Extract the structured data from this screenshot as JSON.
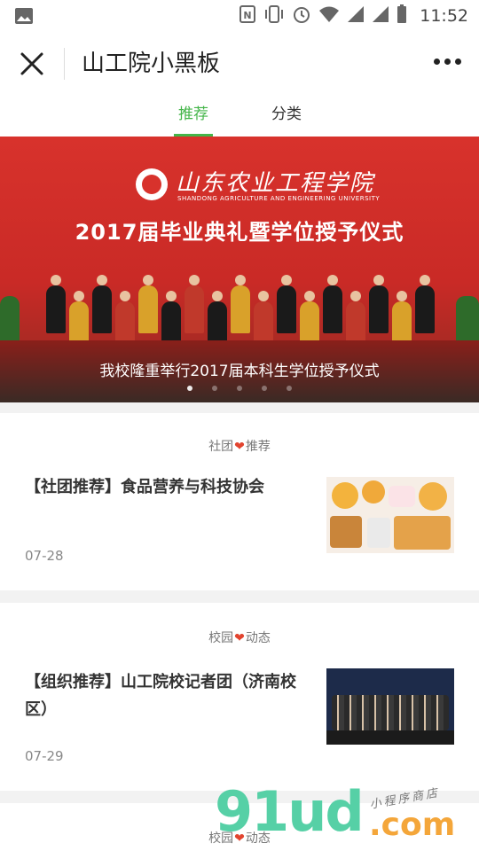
{
  "status_bar": {
    "time": "11:52",
    "icons": [
      "image-icon",
      "nfc-icon",
      "vibrate-icon",
      "alarm-icon",
      "wifi-icon",
      "signal-icon",
      "signal-icon",
      "battery-icon"
    ]
  },
  "nav": {
    "title": "山工院小黑板",
    "close_icon": "close-icon",
    "more_icon": "more-icon"
  },
  "tabs": [
    {
      "label": "推荐",
      "active": true
    },
    {
      "label": "分类",
      "active": false
    }
  ],
  "banner": {
    "school_name": "山东农业工程学院",
    "school_name_en": "SHANDONG AGRICULTURE AND ENGINEERING UNIVERSITY",
    "headline": "2017届毕业典礼暨学位授予仪式",
    "caption": "我校隆重举行2017届本科生学位授予仪式",
    "slide_count": 5,
    "active_slide": 0
  },
  "articles": [
    {
      "category_left": "社团",
      "category_right": "推荐",
      "title": "【社团推荐】食品营养与科技协会",
      "date": "07-28",
      "image": "food-collage"
    },
    {
      "category_left": "校园",
      "category_right": "动态",
      "title": "【组织推荐】山工院校记者团（济南校区）",
      "date": "07-29",
      "image": "group-photo"
    },
    {
      "category_left": "校园",
      "category_right": "动态"
    }
  ],
  "heart": "❤",
  "watermark": {
    "brand": "91ud",
    "suffix": ".com",
    "tagline": "小程序商店"
  },
  "colors": {
    "accent": "#44b549",
    "heart": "#e2442f",
    "banner_red": "#d8322c"
  }
}
